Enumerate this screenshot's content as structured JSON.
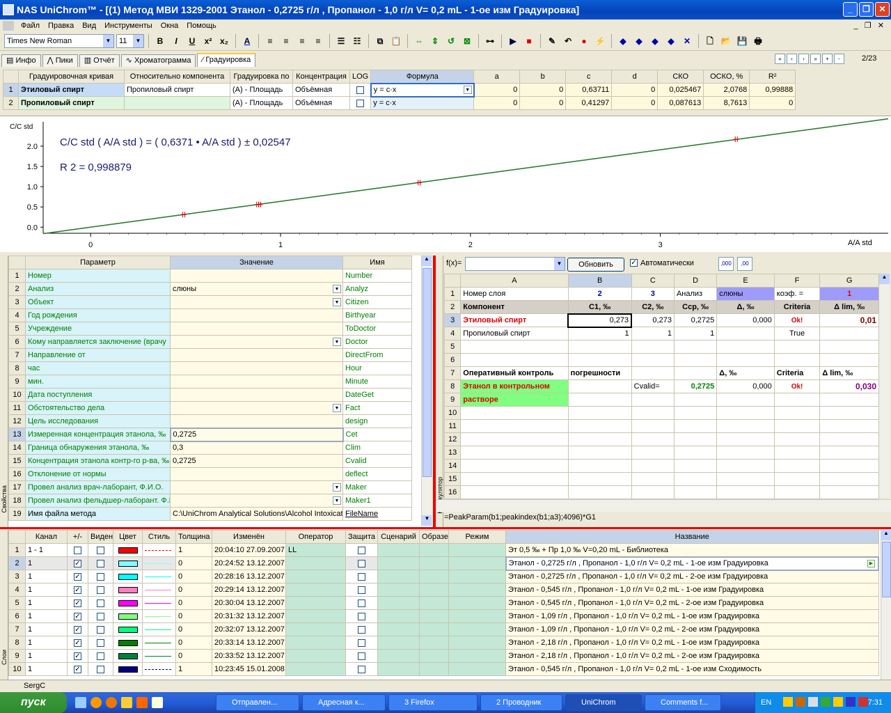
{
  "window": {
    "title": "NAS UniChrom™ - [(1) Метод МВИ 1329-2001    Этанол - 0,2725 г/л ,  Пропанол - 1,0  г/л V= 0,2 mL -  1-ое изм Градуировка]"
  },
  "menu": [
    "Файл",
    "Правка",
    "Вид",
    "Инструменты",
    "Окна",
    "Помощь"
  ],
  "toolbar": {
    "font": "Times New Roman",
    "size": "11",
    "bold": "B",
    "italic": "I",
    "underline": "U",
    "sup": "x²",
    "sub": "x₂"
  },
  "tabs": [
    "Инфо",
    "Пики",
    "Отчёт",
    "Хроматограмма",
    "Градуировка"
  ],
  "page_indicator": "2/23",
  "calib": {
    "headers": [
      "Градуировочная кривая",
      "Относительно компонента",
      "Градуировка по",
      "Концентрация",
      "LOG",
      "Формула",
      "a",
      "b",
      "c",
      "d",
      "СКО",
      "ОСКО, %",
      "R²"
    ],
    "rows": [
      {
        "n": "1",
        "curve": "Этиловый спирт",
        "rel": "Пропиловый спирт",
        "by": "(A) - Площадь",
        "conc": "Объёмная",
        "formula": "y = c·x",
        "a": "0",
        "b": "0",
        "c": "0,63711",
        "d": "0",
        "sko": "0,025467",
        "osko": "2,0768",
        "r2": "0,99888"
      },
      {
        "n": "2",
        "curve": "Пропиловый спирт",
        "rel": "",
        "by": "(A) - Площадь",
        "conc": "Объёмная",
        "formula": "y = c·x",
        "a": "0",
        "b": "0",
        "c": "0,41297",
        "d": "0",
        "sko": "0,087613",
        "osko": "8,7613",
        "r2": "0"
      }
    ]
  },
  "chart_data": {
    "type": "line",
    "equation": "C/C std ( A/A std ) = ( 0,6371 • A/A std ) ± 0,02547",
    "r2_label": "R 2 = 0,998879",
    "ylabel": "C/C std",
    "xlabel": "A/A std",
    "xlim": [
      -0.25,
      4.2
    ],
    "ylim": [
      -0.15,
      2.6
    ],
    "xticks": [
      "0",
      "1",
      "2",
      "3"
    ],
    "yticks": [
      "0.0",
      "0.5",
      "1.0",
      "1.5",
      "2.0"
    ],
    "series": [
      {
        "values": [
          [
            -0.25,
            -0.159
          ],
          [
            4.2,
            2.676
          ]
        ]
      }
    ],
    "points": [
      [
        0.49,
        0.31
      ],
      [
        0.88,
        0.56
      ],
      [
        0.89,
        0.56
      ],
      [
        1.73,
        1.1
      ],
      [
        3.4,
        2.17
      ]
    ]
  },
  "props": {
    "headers": [
      "Параметр",
      "Значение",
      "Имя"
    ],
    "side_label": "Свойства",
    "rows": [
      {
        "n": "1",
        "p": "Номер",
        "v": "",
        "name": "Number"
      },
      {
        "n": "2",
        "p": "Анализ",
        "v": "слюны",
        "name": "Analyz",
        "dd": true
      },
      {
        "n": "3",
        "p": "Объект",
        "v": "",
        "name": "Citizen",
        "dd": true
      },
      {
        "n": "4",
        "p": "Год рождения",
        "v": "",
        "name": "Birthyear"
      },
      {
        "n": "5",
        "p": "Учреждение",
        "v": "",
        "name": "ToDoctor"
      },
      {
        "n": "6",
        "p": "Кому направляется заключение (врачу",
        "v": "",
        "name": "Doctor",
        "dd": true
      },
      {
        "n": "7",
        "p": "Направление от",
        "v": "",
        "name": "DirectFrom"
      },
      {
        "n": "8",
        "p": "час",
        "v": "",
        "name": "Hour"
      },
      {
        "n": "9",
        "p": "мин.",
        "v": "",
        "name": "Minute"
      },
      {
        "n": "10",
        "p": "Дата поступления",
        "v": "",
        "name": "DateGet"
      },
      {
        "n": "11",
        "p": "Обстоятельство дела",
        "v": "",
        "name": "Fact",
        "dd": true
      },
      {
        "n": "12",
        "p": "Цель исследования",
        "v": "",
        "name": "design"
      },
      {
        "n": "13",
        "p": "Измеренная концентрация этанола,  ‰",
        "v": "0,2725",
        "name": "Cet"
      },
      {
        "n": "14",
        "p": "Граница обнаружения этанола,       ‰",
        "v": "0,3",
        "name": "Clim"
      },
      {
        "n": "15",
        "p": "Концентрация этанола контр-го р-ва,  ‰",
        "v": "0,2725",
        "name": "Cvalid"
      },
      {
        "n": "16",
        "p": "Отклонение от нормы",
        "v": "",
        "name": "deflect"
      },
      {
        "n": "17",
        "p": "Провел анализ врач-лаборант, Ф.И.О.",
        "v": "",
        "name": "Maker",
        "dd": true
      },
      {
        "n": "18",
        "p": "Провел анализ фельдшер-лаборант. Ф.И",
        "v": "",
        "name": "Maker1",
        "dd": true
      },
      {
        "n": "19",
        "p": "Имя файла метода",
        "v": "C:\\UniChrom Analytical Solutions\\Alcohol Intoxicatio",
        "name": "FileName"
      }
    ]
  },
  "sheet": {
    "fx": "f(x)=",
    "refresh": "Обновить",
    "auto": "Автоматически",
    "side_label": "Калькулятор",
    "cols": [
      "A",
      "B",
      "C",
      "D",
      "E",
      "F",
      "G"
    ],
    "formula": "=PeakParam(b1;peakindex(b1;a3);4096)*G1",
    "rows": [
      [
        "Номер слоя",
        "2",
        "3",
        "Анализ",
        "слюны",
        "коэф. =",
        "1"
      ],
      [
        "Компонент",
        "C1,  ‰",
        "C2,  ‰",
        "Cср, ‰",
        "Δ,  ‰",
        "Criteria",
        "Δ lim,  ‰"
      ],
      [
        "Этиловый спирт",
        "0,273",
        "0,273",
        "0,2725",
        "0,000",
        "Ok!",
        "0,01"
      ],
      [
        "Пропиловый спирт",
        "1",
        "1",
        "1",
        "",
        "True",
        ""
      ],
      [
        "",
        "",
        "",
        "",
        "",
        "",
        ""
      ],
      [
        "",
        "",
        "",
        "",
        "",
        "",
        ""
      ],
      [
        "Оперативный контроль",
        "погрешности",
        "",
        "",
        "Δ,  ‰",
        "Criteria",
        "Δ lim,  ‰"
      ],
      [
        "Этанол в контрольном",
        "",
        "Cvalid=",
        "0,2725",
        "0,000",
        "Ok!",
        "0,030"
      ],
      [
        "растворе",
        "",
        "",
        "",
        "",
        "",
        ""
      ],
      [
        "",
        "",
        "",
        "",
        "",
        "",
        ""
      ],
      [
        "",
        "",
        "",
        "",
        "",
        "",
        ""
      ],
      [
        "",
        "",
        "",
        "",
        "",
        "",
        ""
      ],
      [
        "",
        "",
        "",
        "",
        "",
        "",
        ""
      ],
      [
        "",
        "",
        "",
        "",
        "",
        "",
        ""
      ],
      [
        "",
        "",
        "",
        "",
        "",
        "",
        ""
      ],
      [
        "",
        "",
        "",
        "",
        "",
        "",
        ""
      ]
    ]
  },
  "layers": {
    "side_label": "Слои",
    "headers": [
      "Канал",
      "+/-",
      "Виден",
      "Цвет",
      "Стиль",
      "Толщина",
      "Изменён",
      "Оператор",
      "Защита",
      "Сценарий",
      "Образец",
      "Режим",
      "Название"
    ],
    "rows": [
      {
        "n": "1",
        "ch": "1 - 1",
        "plus": false,
        "color": "#ff0000",
        "style": "dash",
        "w": "1",
        "date": "20:04:10 27.09.2007",
        "op": "LL",
        "name": "Эт 0,5 ‰  +  Пр 1,0 ‰           V=0,20 mL - Библиотека"
      },
      {
        "n": "2",
        "ch": "1",
        "plus": true,
        "color": "#80ffff",
        "style": "solid",
        "w": "0",
        "date": "20:24:52 13.12.2007",
        "op": "",
        "name": "Этанол - 0,2725 г/л ,  Пропанол - 1,0  г/л V= 0,2 mL -  1-ое изм Градуировка"
      },
      {
        "n": "3",
        "ch": "1",
        "plus": true,
        "color": "#00ffff",
        "style": "solid",
        "w": "0",
        "date": "20:28:16 13.12.2007",
        "op": "",
        "name": "Этанол - 0,2725 г/л ,  Пропанол - 1,0  г/л V= 0,2 mL -  2-ое изм Градуировка"
      },
      {
        "n": "4",
        "ch": "1",
        "plus": true,
        "color": "#ff80c0",
        "style": "solid",
        "w": "0",
        "date": "20:29:14 13.12.2007",
        "op": "",
        "name": "Этанол - 0,545 г/л ,  Пропанол - 1,0  г/л V= 0,2 mL -  1-ое изм Градуировка"
      },
      {
        "n": "5",
        "ch": "1",
        "plus": true,
        "color": "#ff00ff",
        "style": "solid",
        "w": "0",
        "date": "20:30:04 13.12.2007",
        "op": "",
        "name": "Этанол - 0,545 г/л ,  Пропанол - 1,0  г/л V= 0,2 mL -  2-ое изм Градуировка"
      },
      {
        "n": "6",
        "ch": "1",
        "plus": true,
        "color": "#80ff80",
        "style": "solid",
        "w": "0",
        "date": "20:31:32 13.12.2007",
        "op": "",
        "name": "Этанол - 1,09 г/л ,     Пропанол - 1,0  г/л V= 0,2 mL -  1-ое изм Градуировка"
      },
      {
        "n": "7",
        "ch": "1",
        "plus": true,
        "color": "#00ff80",
        "style": "solid",
        "w": "0",
        "date": "20:32:07 13.12.2007",
        "op": "",
        "name": "Этанол - 1,09 г/л ,     Пропанол - 1,0  г/л V= 0,2 mL -  2-ое изм Градуировка"
      },
      {
        "n": "8",
        "ch": "1",
        "plus": true,
        "color": "#008000",
        "style": "solid",
        "w": "0",
        "date": "20:33:14 13.12.2007",
        "op": "",
        "name": "Этанол - 2,18 г/л ,     Пропанол - 1,0  г/л V= 0,2 mL -  1-ое изм Градуировка"
      },
      {
        "n": "9",
        "ch": "1",
        "plus": true,
        "color": "#008040",
        "style": "solid",
        "w": "0",
        "date": "20:33:52 13.12.2007",
        "op": "",
        "name": "Этанол - 2,18 г/л ,     Пропанол - 1,0  г/л V= 0,2 mL -  2-ое изм Градуировка"
      },
      {
        "n": "10",
        "ch": "1",
        "plus": true,
        "color": "#000080",
        "style": "dashdot",
        "w": "1",
        "date": "10:23:45 15.01.2008",
        "op": "",
        "name": "Этанол - 0,545 г/л ,     Пропанол - 1,0  г/л V= 0,2 mL -  1-ое изм Сходимость"
      }
    ]
  },
  "status": "SergC",
  "taskbar": {
    "start": "пуск",
    "tasks": [
      {
        "label": "Отправлен...",
        "active": false
      },
      {
        "label": "Адресная к...",
        "active": false
      },
      {
        "label": "3 Firefox",
        "active": false
      },
      {
        "label": "2 Проводник",
        "active": false
      },
      {
        "label": "UniChrom",
        "active": true
      },
      {
        "label": "Comments f...",
        "active": false
      }
    ],
    "lang": "EN",
    "clock": "17:31"
  }
}
